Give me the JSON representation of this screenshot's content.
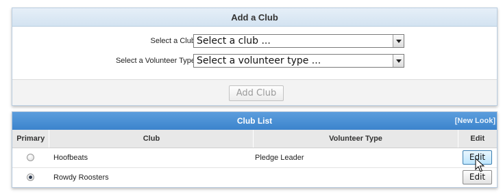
{
  "add_club": {
    "title": "Add a Club",
    "club_label": "Select a Club:",
    "club_select_value": "Select a club ...",
    "volunteer_label": "Select a Volunteer Type:",
    "volunteer_select_value": "Select a volunteer type ...",
    "add_button_label": "Add Club"
  },
  "club_list": {
    "title": "Club List",
    "new_look_link": "[New Look]",
    "columns": {
      "primary": "Primary",
      "club": "Club",
      "volunteer_type": "Volunteer Type",
      "edit": "Edit"
    },
    "rows": [
      {
        "primary": false,
        "club": "Hoofbeats",
        "volunteer_type": "Pledge Leader",
        "edit_label": "Edit"
      },
      {
        "primary": true,
        "club": "Rowdy Roosters",
        "volunteer_type": "",
        "edit_label": "Edit"
      }
    ]
  },
  "colors": {
    "list_header": "#4a90d6",
    "add_header": "#dce8f4"
  },
  "icons": [
    "chevron-down-icon",
    "radio-icon",
    "mouse-pointer-icon"
  ]
}
